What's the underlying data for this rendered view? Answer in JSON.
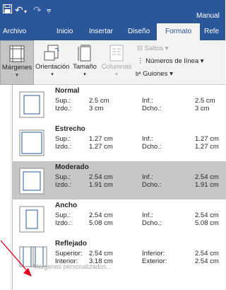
{
  "quick_access": {
    "save_icon": "save-icon",
    "undo_icon": "undo-icon",
    "redo_icon": "redo-icon",
    "customize_icon": "customize-icon",
    "window_title": "Manual"
  },
  "tabs": [
    {
      "label": "Archivo"
    },
    {
      "label": "Inicio"
    },
    {
      "label": "Insertar"
    },
    {
      "label": "Diseño"
    },
    {
      "label": "Formato",
      "active": true
    },
    {
      "label": "Refe"
    }
  ],
  "ribbon": {
    "margins_label": "Márgenes",
    "orientation_label": "Orientación",
    "size_label": "Tamaño",
    "columns_label": "Columnas",
    "breaks_label": "Saltos",
    "line_numbers_label": "Números de línea",
    "hyphenation_label": "Guiones",
    "dropdown_arrow": "▾"
  },
  "margins_menu": {
    "options": [
      {
        "name": "Normal",
        "r1_label": "Sup.:",
        "r1_value": "2.5 cm",
        "r1_label2": "Inf.:",
        "r1_value2": "2.5 cm",
        "r2_label": "Izdo.:",
        "r2_value": "3 cm",
        "r2_label2": "Dcho.:",
        "r2_value2": "3 cm"
      },
      {
        "name": "Estrecho",
        "r1_label": "Sup.:",
        "r1_value": "1.27 cm",
        "r1_label2": "Inf.:",
        "r1_value2": "1.27 cm",
        "r2_label": "Izdo.:",
        "r2_value": "1.27 cm",
        "r2_label2": "Dcho.:",
        "r2_value2": "1.27 cm"
      },
      {
        "name": "Moderado",
        "selected": true,
        "r1_label": "Sup.:",
        "r1_value": "2.54 cm",
        "r1_label2": "Inf.:",
        "r1_value2": "2.54 cm",
        "r2_label": "Izdo.:",
        "r2_value": "1.91 cm",
        "r2_label2": "Dcho.:",
        "r2_value2": "1.91 cm"
      },
      {
        "name": "Ancho",
        "r1_label": "Sup.:",
        "r1_value": "2.54 cm",
        "r1_label2": "Inf.:",
        "r1_value2": "2.54 cm",
        "r2_label": "Izdo.:",
        "r2_value": "5.08 cm",
        "r2_label2": "Dcho.:",
        "r2_value2": "5.08 cm"
      },
      {
        "name": "Reflejado",
        "r1_label": "Superior:",
        "r1_value": "2.54 cm",
        "r1_label2": "Inferior:",
        "r1_value2": "2.54 cm",
        "r2_label": "Interior:",
        "r2_value": "3.18 cm",
        "r2_label2": "Exterior:",
        "r2_value2": "2.54 cm"
      }
    ],
    "custom_label": "Márgenes personalizados..."
  },
  "colors": {
    "title_bar": "#2b579a",
    "ribbon": "#f3f3f3",
    "selected_option": "#c6c6c6",
    "annotation_arrow": "#e3001b"
  }
}
